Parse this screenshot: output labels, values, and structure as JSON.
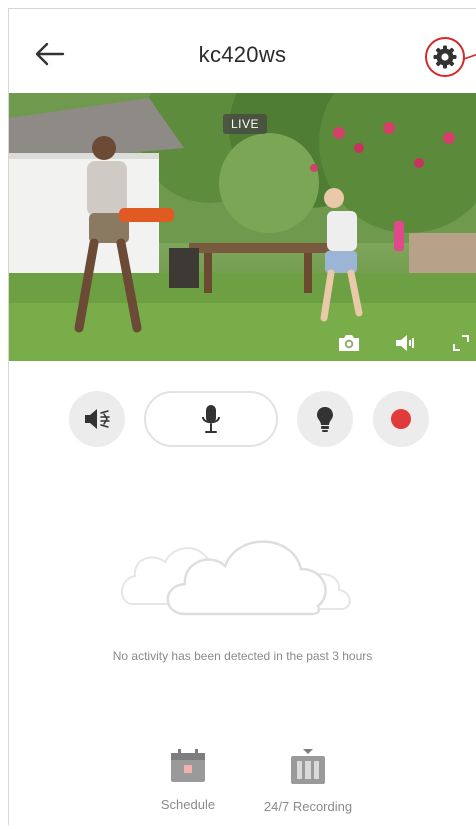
{
  "header": {
    "back_icon": "arrow-left-icon",
    "title": "kc420ws",
    "settings_icon": "gear-icon",
    "accent_color": "#d42a2a"
  },
  "video": {
    "live_label": "LIVE",
    "snapshot_icon": "camera-icon",
    "volume_icon": "speaker-icon",
    "fullscreen_icon": "fullscreen-icon"
  },
  "controls": {
    "speaker_icon": "speaker-mute-icon",
    "mic_icon": "microphone-icon",
    "light_icon": "light-bulb-icon",
    "record_icon": "record-icon",
    "record_color": "#e03a3a"
  },
  "activity": {
    "empty_icon": "cloud-icon",
    "empty_message": "No activity has been detected in the past 3 hours"
  },
  "bottom_bar": {
    "schedule_label": "Schedule",
    "recording_label": "24/7 Recording"
  }
}
